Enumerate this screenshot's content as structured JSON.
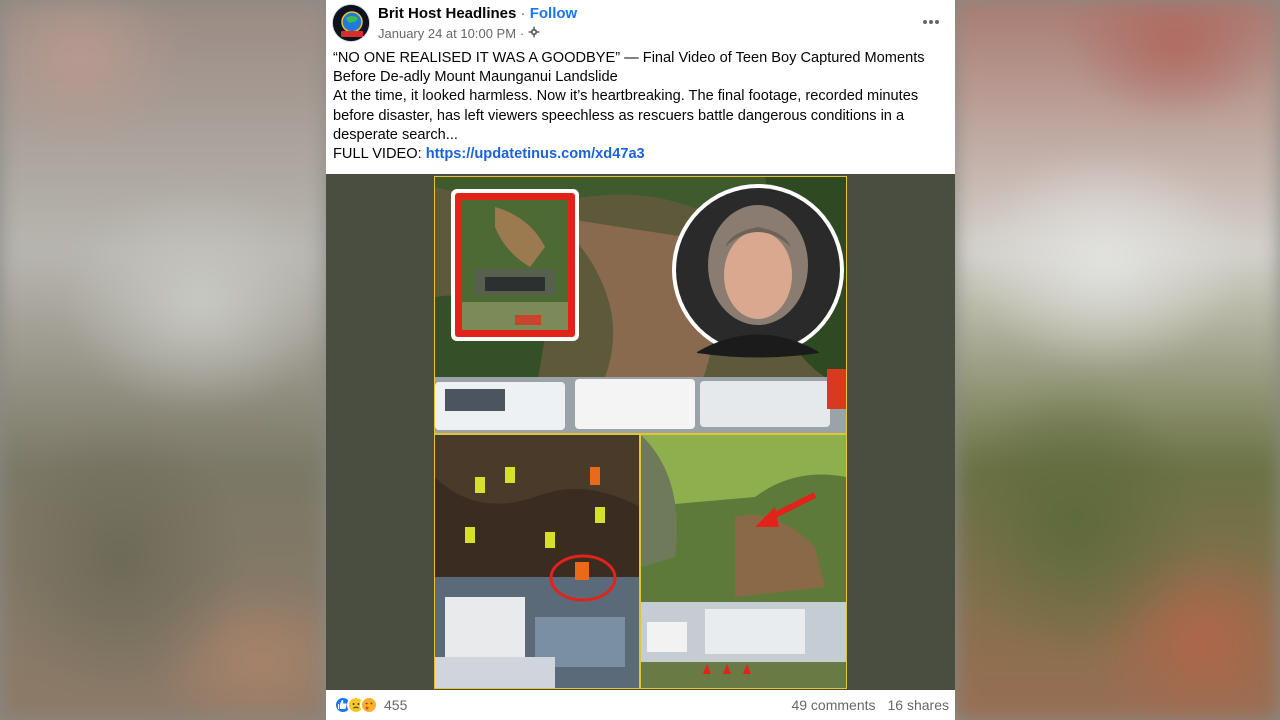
{
  "post": {
    "page_name": "Brit Host Headlines",
    "separator": " · ",
    "follow_label": "Follow",
    "timestamp": "January 24 at 10:00 PM",
    "meta_separator": "·",
    "audience_icon": "gear-icon",
    "more_icon": "more-options-icon",
    "avatar_text": "BRIT HOST",
    "text": {
      "headline": "“NO ONE REALISED IT WAS A GOODBYE” — Final Video of Teen Boy Captured Moments Before De-adly Mount Maunganui Landslide",
      "body": "At the time, it looked harmless. Now it’s heartbreaking. The final footage, recorded minutes before disaster, has left viewers speechless as rescuers battle dangerous conditions in a desperate search...",
      "link_prefix": "FULL VIDEO: ",
      "link_text": "https://updatetinus.com/xd47a3"
    }
  },
  "footer": {
    "reaction_icons": [
      "like-icon",
      "sad-icon",
      "care-icon"
    ],
    "reaction_count": "455",
    "comments": "49 comments",
    "shares": "16 shares"
  },
  "colors": {
    "link": "#1877f2",
    "media_bg": "#4a4e40",
    "collage_border": "#e1c535",
    "highlight_red": "#e2231a"
  }
}
